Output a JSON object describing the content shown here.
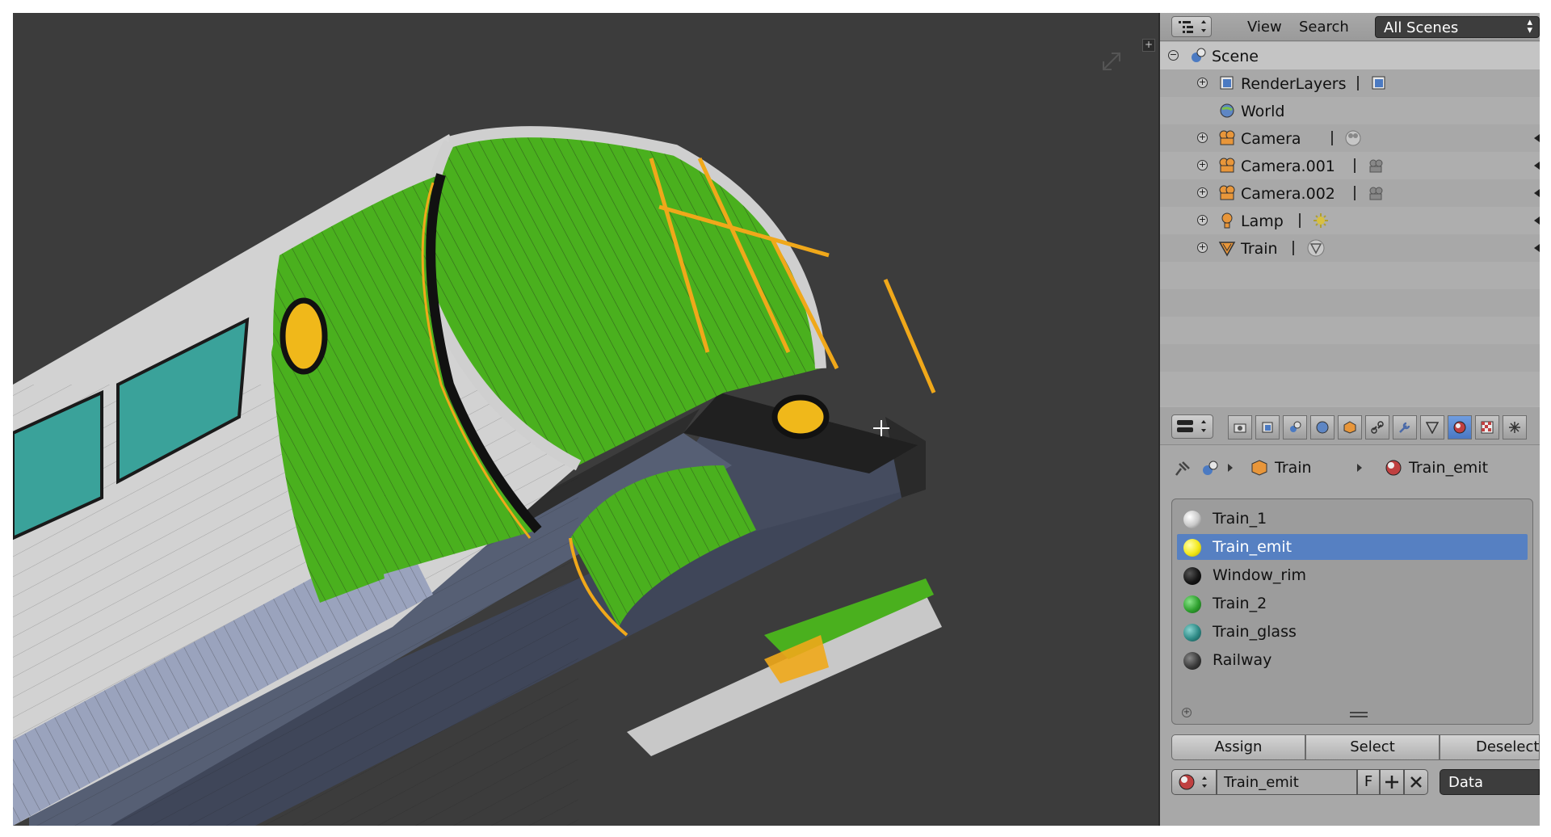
{
  "outliner_header": {
    "menu_view": "View",
    "menu_search": "Search",
    "scene_filter": "All Scenes"
  },
  "outliner": {
    "items": [
      {
        "label": "Scene"
      },
      {
        "label": "RenderLayers"
      },
      {
        "label": "World"
      },
      {
        "label": "Camera"
      },
      {
        "label": "Camera.001"
      },
      {
        "label": "Camera.002"
      },
      {
        "label": "Lamp"
      },
      {
        "label": "Train"
      }
    ]
  },
  "properties": {
    "breadcrumb": {
      "object": "Train",
      "material": "Train_emit"
    },
    "material_slots": [
      {
        "name": "Train_1",
        "color": "#c8c8c8"
      },
      {
        "name": "Train_emit",
        "color": "#f2e81a",
        "selected": true
      },
      {
        "name": "Window_rim",
        "color": "#161616"
      },
      {
        "name": "Train_2",
        "color": "#2ea02e"
      },
      {
        "name": "Train_glass",
        "color": "#2e8a86"
      },
      {
        "name": "Railway",
        "color": "#3a3a3a"
      }
    ],
    "buttons": {
      "assign": "Assign",
      "select": "Select",
      "deselect": "Deselect"
    },
    "material_name": "Train_emit",
    "fake_user": "F",
    "link_dropdown": "Data"
  },
  "colors": {
    "selection": "#5680c2",
    "mesh_green": "#4ab01e",
    "edge_orange": "#f0a81a",
    "window_teal": "#3aa29a"
  }
}
